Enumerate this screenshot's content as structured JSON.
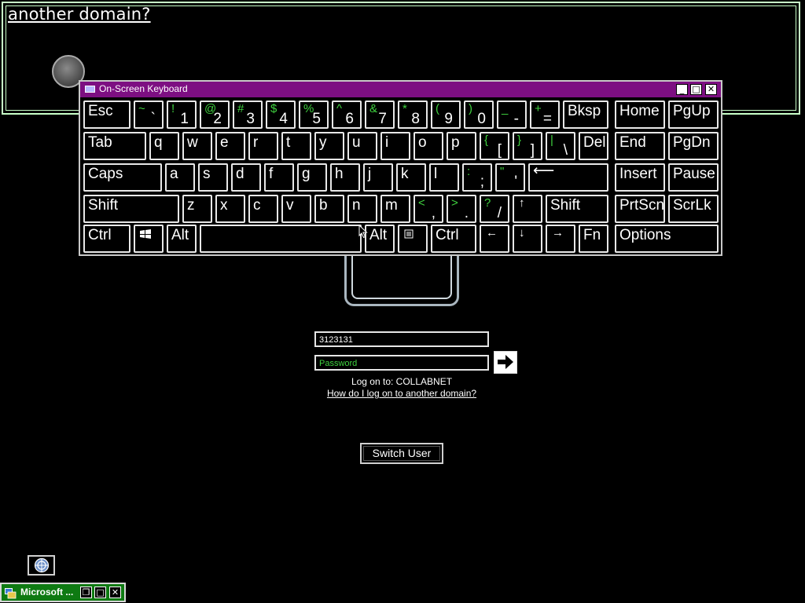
{
  "magnifier": {
    "text": "another domain?"
  },
  "osk": {
    "title": "On-Screen Keyboard",
    "minimize_glyph": "_",
    "maximize_glyph": "□",
    "close_glyph": "✕"
  },
  "keys": {
    "esc": "Esc",
    "backtick": {
      "shift": "~",
      "main": "`"
    },
    "n1": {
      "shift": "!",
      "main": "1"
    },
    "n2": {
      "shift": "@",
      "main": "2"
    },
    "n3": {
      "shift": "#",
      "main": "3"
    },
    "n4": {
      "shift": "$",
      "main": "4"
    },
    "n5": {
      "shift": "%",
      "main": "5"
    },
    "n6": {
      "shift": "^",
      "main": "6"
    },
    "n7": {
      "shift": "&",
      "main": "7"
    },
    "n8": {
      "shift": "*",
      "main": "8"
    },
    "n9": {
      "shift": "(",
      "main": "9"
    },
    "n0": {
      "shift": ")",
      "main": "0"
    },
    "minus": {
      "shift": "_",
      "main": "-"
    },
    "equals": {
      "shift": "+",
      "main": "="
    },
    "bksp": "Bksp",
    "home": "Home",
    "pgup": "PgUp",
    "tab": "Tab",
    "q": "q",
    "w": "w",
    "e": "e",
    "r": "r",
    "t": "t",
    "y": "y",
    "u": "u",
    "i": "i",
    "o": "o",
    "p": "p",
    "lbracket": {
      "shift": "{",
      "main": "["
    },
    "rbracket": {
      "shift": "}",
      "main": "]"
    },
    "backslash": {
      "shift": "|",
      "main": "\\"
    },
    "del": "Del",
    "end": "End",
    "pgdn": "PgDn",
    "caps": "Caps",
    "a": "a",
    "s": "s",
    "d": "d",
    "f": "f",
    "g": "g",
    "h": "h",
    "j": "j",
    "k": "k",
    "l": "l",
    "semicolon": {
      "shift": ":",
      "main": ";"
    },
    "quote": {
      "shift": "\"",
      "main": "'"
    },
    "enter": "⟵",
    "insert": "Insert",
    "pause": "Pause",
    "shift_l": "Shift",
    "z": "z",
    "x": "x",
    "c": "c",
    "v": "v",
    "b": "b",
    "n": "n",
    "m": "m",
    "comma": {
      "shift": "<",
      "main": ","
    },
    "period": {
      "shift": ">",
      "main": "."
    },
    "slash": {
      "shift": "?",
      "main": "/"
    },
    "up": "↑",
    "shift_r": "Shift",
    "prtscn": "PrtScn",
    "scrlk": "ScrLk",
    "ctrl_l": "Ctrl",
    "alt_l": "Alt",
    "alt_r": "Alt",
    "ctrl_r": "Ctrl",
    "left": "←",
    "down": "↓",
    "right": "→",
    "fn": "Fn",
    "options": "Options"
  },
  "logon": {
    "username_value": "3123131",
    "password_placeholder": "Password",
    "logon_to": "Log on to: COLLABNET",
    "help_link": "How do I log on to another domain?",
    "switch_user": "Switch User"
  },
  "taskbar": {
    "title": "Microsoft ...",
    "restore_glyph": "❐",
    "maximize_glyph": "□",
    "close_glyph": "✕"
  }
}
